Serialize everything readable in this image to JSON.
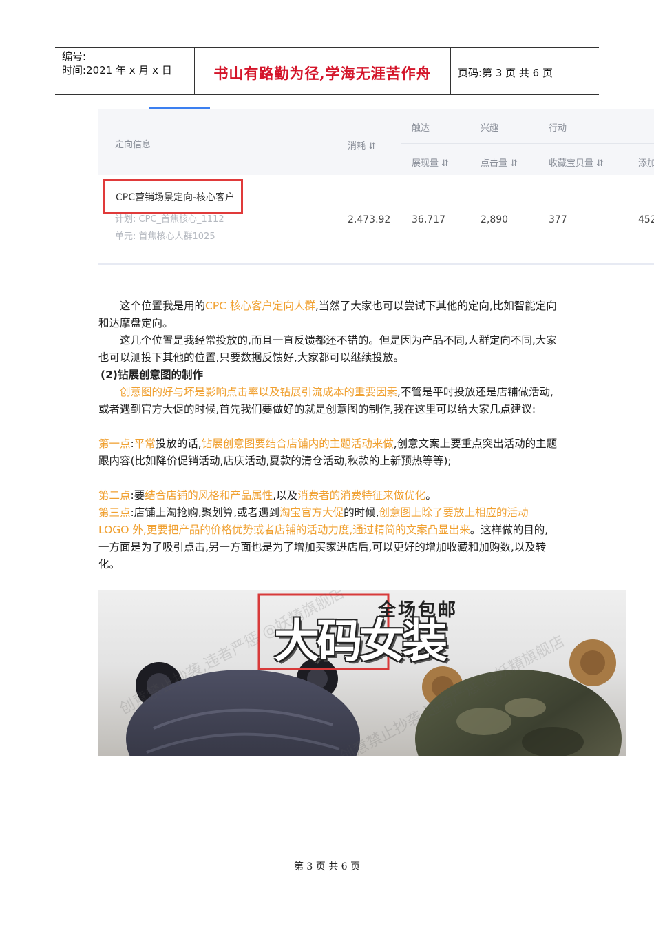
{
  "header": {
    "number_label": "编号:",
    "date_label": "时间:2021 年 x 月 x 日",
    "motto": "书山有路勤为径,学海无涯苦作舟",
    "page_info": "页码:第 3 页  共 6 页"
  },
  "table": {
    "col_targeting": "定向信息",
    "col_cost": "消耗 ⇵",
    "group_reach": "触达",
    "group_interest": "兴趣",
    "group_action": "行动",
    "col_impressions": "展现量 ⇵",
    "col_clicks": "点击量 ⇵",
    "col_favorites": "收藏宝贝量 ⇵",
    "col_add": "添加",
    "row": {
      "name": "CPC营销场景定向-核心客户",
      "plan": "计划: CPC_首焦核心_1112",
      "unit": "单元: 首焦核心人群1025",
      "cost": "2,473.92",
      "impressions": "36,717",
      "clicks": "2,890",
      "favorites": "377",
      "add": "452"
    }
  },
  "body": {
    "p1_a": "这个位置我是用的",
    "p1_b": "CPC 核心客户定向人群",
    "p1_c": ",当然了大家也可以尝试下其他的定向,比如智能定向和达摩盘定向。",
    "p2": "这几个位置是我经常投放的,而且一直反馈都还不错的。但是因为产品不同,人群定向不同,大家也可以测投下其他的位置,只要数据反馈好,大家都可以继续投放。",
    "h2": "(2)钻展创意图的制作",
    "p3_a": "创意图的好与坏是影响点击率以及钻展引流成本的重要因素",
    "p3_b": ",不管是平时投放还是店铺做活动,或者遇到官方大促的时候,首先我们要做好的就是创意图的制作,我在这里可以给大家几点建议:",
    "p4_a": "第一点",
    "p4_b": ":",
    "p4_c": "平常",
    "p4_d": "投放的话,",
    "p4_e": "钻展创意图要结合店铺内的主题活动来做",
    "p4_f": ",创意文案上要重点突出活动的主题跟内容(比如降价促销活动,店庆活动,夏款的清仓活动,秋款的上新预热等等);",
    "p5_a": "第二点",
    "p5_b": ":要",
    "p5_c": "结合店铺的风格和产品属性",
    "p5_d": ",以及",
    "p5_e": "消费者的消费特征来做优化",
    "p5_f": "。",
    "p6_a": "第三点",
    "p6_b": ":店铺上淘抢购,聚划算,或者遇到",
    "p6_c": "淘宝官方大促",
    "p6_d": "的时候,",
    "p6_e": "创意图上除了要放上相应的活动 LOGO 外,更要把产品的价格优势或者店铺的活动力度,通过精简的文案凸显出来",
    "p6_f": "。这样做的目的,一方面是为了吸引点击,另一方面也是为了增加买家进店后,可以更好的增加收藏和加购数,以及转化。"
  },
  "banner": {
    "tagline": "全场包邮",
    "title": "大码女装",
    "watermark": "创意禁止抄袭,违者严惩 @妖精旗舰店"
  },
  "footer": "第 3 页 共 6 页",
  "colors": {
    "accent": "#f0a030",
    "motto": "#d4152a",
    "highlight_box": "#e03a3a",
    "tab": "#3b7ff0"
  }
}
